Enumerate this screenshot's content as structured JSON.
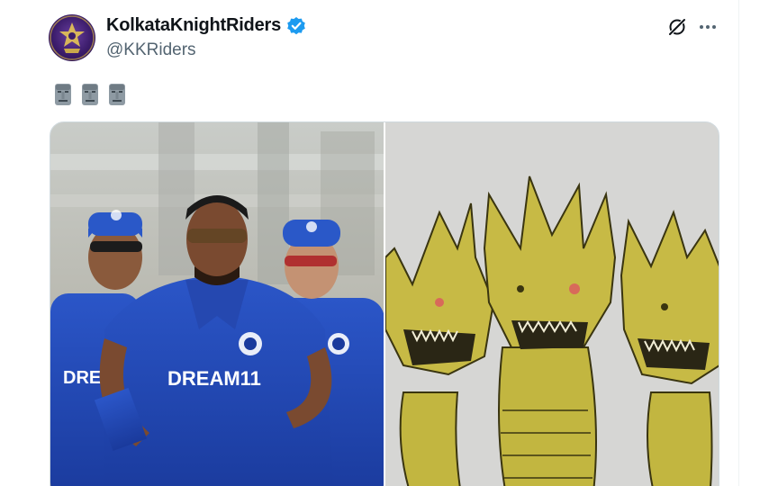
{
  "post": {
    "author_name": "KolkataKnightRiders",
    "handle": "@KKRiders",
    "text_emojis": [
      "moai-emoji",
      "moai-emoji",
      "moai-emoji"
    ],
    "verified_color": "#1d9bf0"
  },
  "media": {
    "images": [
      {
        "name": "players-jogging-photo",
        "jersey_text": "DREAM11"
      },
      {
        "name": "three-headed-dragon-meme"
      }
    ]
  },
  "icons": {
    "grok": "grok-icon",
    "more": "more-options-icon"
  }
}
